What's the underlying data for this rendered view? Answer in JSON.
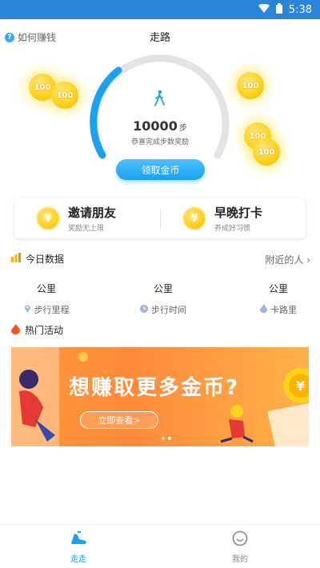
{
  "statusbar": {
    "time": "5:38"
  },
  "header": {
    "how_to_earn": "如何赚钱",
    "title": "走路"
  },
  "coins": [
    "100",
    "100",
    "100",
    "100",
    "100"
  ],
  "steps": {
    "value": "10000",
    "unit": "步",
    "subtitle": "恭喜完成步数奖励",
    "claim_button": "领取金币",
    "progress": 0.2
  },
  "cards": [
    {
      "title": "邀请朋友",
      "subtitle": "奖励无上限",
      "icon": "¥"
    },
    {
      "title": "早晚打卡",
      "subtitle": "养成好习惯",
      "icon": "¥"
    }
  ],
  "today": {
    "title": "今日数据",
    "nearby": "附近的人 ›",
    "stats": [
      {
        "unit": "公里",
        "label": "步行里程",
        "icon": "location-icon"
      },
      {
        "unit": "公里",
        "label": "步行时间",
        "icon": "clock-icon"
      },
      {
        "unit": "公里",
        "label": "卡路里",
        "icon": "flame-icon"
      }
    ]
  },
  "hot": {
    "title": "热门活动",
    "banner_headline": "想赚取更多金币?",
    "banner_cta": "立即查看>"
  },
  "tabs": [
    {
      "label": "走走",
      "active": true
    },
    {
      "label": "我的",
      "active": false
    }
  ],
  "colors": {
    "accent": "#1aa1f0",
    "statusbar": "#2a84d8",
    "banner": "#ff8a3a",
    "coin": "#ffd21d"
  }
}
